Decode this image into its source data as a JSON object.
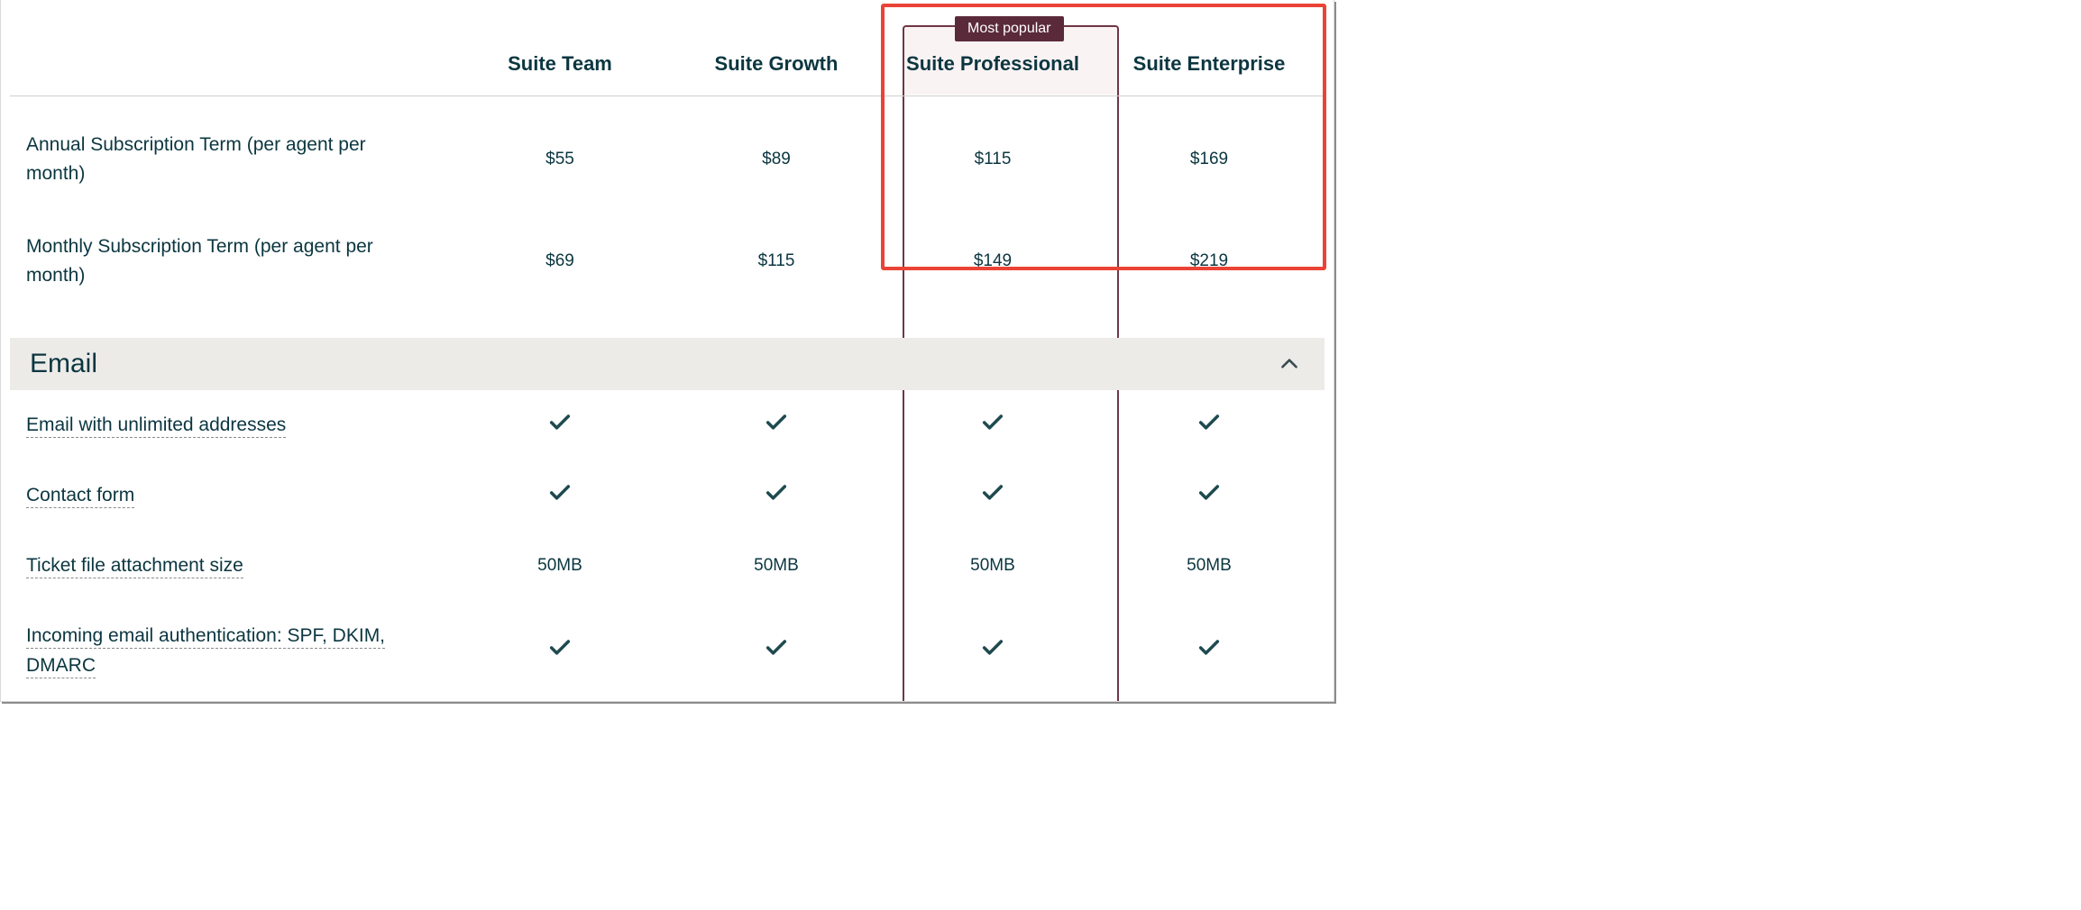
{
  "highlight": {
    "startPlanIndex": 2,
    "endPlanIndex": 3
  },
  "popular": {
    "badge": "Most popular",
    "planIndex": 2
  },
  "plans": [
    {
      "name": "Suite Team"
    },
    {
      "name": "Suite Growth"
    },
    {
      "name": "Suite Professional"
    },
    {
      "name": "Suite Enterprise"
    }
  ],
  "pricing": [
    {
      "label": "Annual Subscription Term (per agent per month)",
      "values": [
        "$55",
        "$89",
        "$115",
        "$169"
      ]
    },
    {
      "label": "Monthly Subscription Term (per agent per month)",
      "values": [
        "$69",
        "$115",
        "$149",
        "$219"
      ]
    }
  ],
  "section": {
    "title": "Email",
    "expanded": true
  },
  "features": [
    {
      "label": "Email with unlimited addresses",
      "values": [
        "check",
        "check",
        "check",
        "check"
      ]
    },
    {
      "label": "Contact form",
      "values": [
        "check",
        "check",
        "check",
        "check"
      ]
    },
    {
      "label": "Ticket file attachment size",
      "values": [
        "50MB",
        "50MB",
        "50MB",
        "50MB"
      ]
    },
    {
      "label": "Incoming email authentication: SPF, DKIM, DMARC",
      "values": [
        "check",
        "check",
        "check",
        "check"
      ]
    }
  ]
}
